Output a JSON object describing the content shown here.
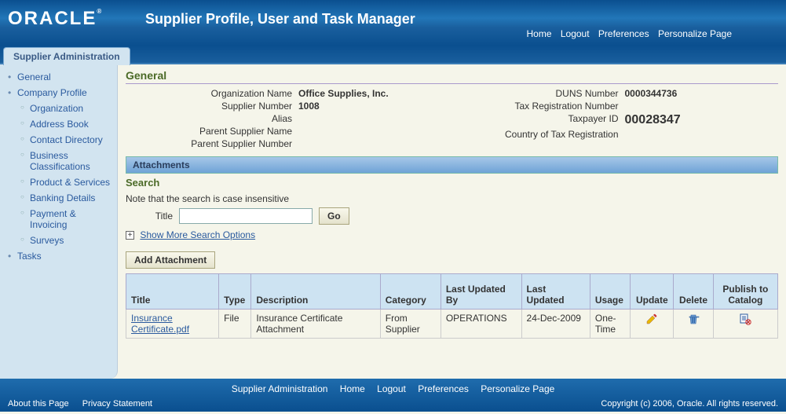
{
  "header": {
    "logo_text": "ORACLE",
    "app_title": "Supplier Profile, User and Task Manager",
    "links": {
      "home": "Home",
      "logout": "Logout",
      "prefs": "Preferences",
      "personalize": "Personalize Page"
    }
  },
  "tab": {
    "active": "Supplier Administration"
  },
  "sidebar": {
    "general": "General",
    "company_profile": "Company Profile",
    "organization": "Organization",
    "address_book": "Address Book",
    "contact_directory": "Contact Directory",
    "business_classifications": "Business Classifications",
    "product_services": "Product & Services",
    "banking_details": "Banking Details",
    "payment_invoicing": "Payment & Invoicing",
    "surveys": "Surveys",
    "tasks": "Tasks"
  },
  "general": {
    "title": "General",
    "labels": {
      "org_name": "Organization Name",
      "supplier_number": "Supplier Number",
      "alias": "Alias",
      "parent_supplier_name": "Parent Supplier Name",
      "parent_supplier_number": "Parent Supplier Number",
      "duns": "DUNS Number",
      "tax_reg": "Tax Registration Number",
      "taxpayer_id": "Taxpayer ID",
      "country_tax": "Country of Tax Registration"
    },
    "values": {
      "org_name": "Office Supplies, Inc.",
      "supplier_number": "1008",
      "alias": "",
      "parent_supplier_name": "",
      "parent_supplier_number": "",
      "duns": "0000344736",
      "tax_reg": "",
      "taxpayer_id": "00028347",
      "country_tax": ""
    }
  },
  "attachments": {
    "header": "Attachments",
    "search_title": "Search",
    "note": "Note that the search is case insensitive",
    "title_label": "Title",
    "go_label": "Go",
    "show_more": "Show More Search Options",
    "add_button": "Add Attachment",
    "columns": {
      "title": "Title",
      "type": "Type",
      "description": "Description",
      "category": "Category",
      "last_updated_by": "Last Updated By",
      "last_updated": "Last Updated",
      "usage": "Usage",
      "update": "Update",
      "delete": "Delete",
      "publish": "Publish to Catalog"
    },
    "rows": [
      {
        "title": "Insurance Certificate.pdf",
        "type": "File",
        "description": "Insurance Certificate Attachment",
        "category": "From Supplier",
        "last_updated_by": "OPERATIONS",
        "last_updated": "24-Dec-2009",
        "usage": "One-Time"
      }
    ]
  },
  "footer": {
    "links": {
      "supplier_admin": "Supplier Administration",
      "home": "Home",
      "logout": "Logout",
      "prefs": "Preferences",
      "personalize": "Personalize Page"
    },
    "about": "About this Page",
    "privacy": "Privacy Statement",
    "copyright": "Copyright (c) 2006, Oracle. All rights reserved."
  }
}
